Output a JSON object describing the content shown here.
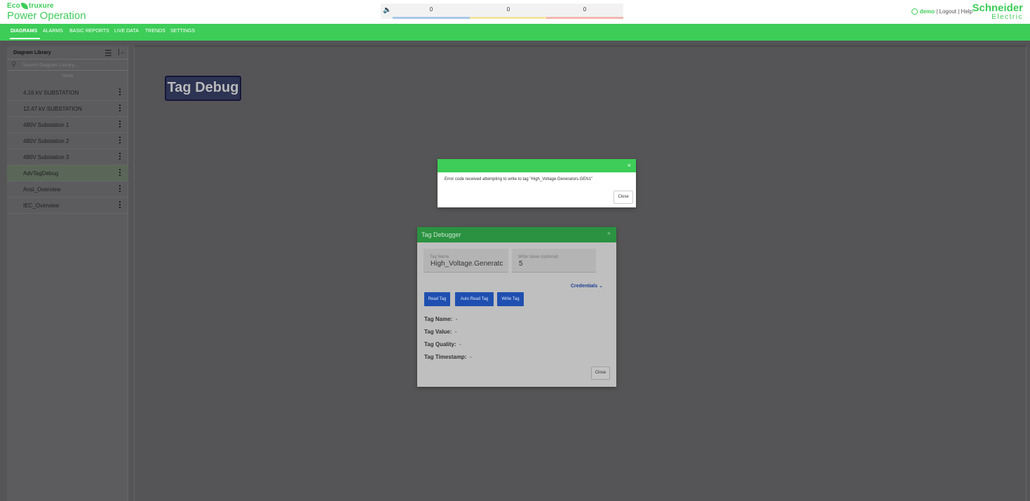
{
  "header": {
    "logo_top": "truxure",
    "logo_prefix": "Eco",
    "app_name": "Power Operation",
    "alarm_counts": [
      "0",
      "0",
      "0"
    ],
    "alarm_colors": [
      "#a9c8ea",
      "#f3e3a2",
      "#f1b8b0"
    ],
    "user": "demo",
    "sep1": "|",
    "logout": "Logout",
    "sep2": "|",
    "help": "Help",
    "brand_line1": "Schneider",
    "brand_line2": "Electric"
  },
  "nav": {
    "items": [
      "DIAGRAMS",
      "ALARMS",
      "BASIC REPORTS",
      "LIVE DATA",
      "TRENDS",
      "SETTINGS"
    ]
  },
  "sidebar": {
    "title": "Diagram Library",
    "search_placeholder": "Search Diagram Library...",
    "home": "Home",
    "items": [
      "4.16 kV SUBSTATION",
      "12.47 kV SUBSTATION",
      "480V Substation 1",
      "480V Substation 2",
      "480V Substation 3",
      "AdvTagDebug",
      "Ansi_Overview",
      "IEC_Overview"
    ],
    "active_index": 5
  },
  "canvas": {
    "tag_debug_button": "Tag Debug"
  },
  "error_dialog": {
    "close_x": "×",
    "message": "Error code received attempting to write to tag \"High_Voltage.Generators.GEN1\"",
    "close_button": "Close"
  },
  "tag_debugger": {
    "title": "Tag Debugger",
    "close_x": "×",
    "tag_name_label": "Tag Name",
    "tag_name_value": "High_Voltage.Generatc",
    "write_value_label": "Write Value (optional)",
    "write_value": "5",
    "credentials": "Credentials",
    "buttons": [
      "Read Tag",
      "Auto Read Tag",
      "Write Tag"
    ],
    "info": [
      {
        "label": "Tag Name:",
        "value": "-"
      },
      {
        "label": "Tag Value:",
        "value": "-"
      },
      {
        "label": "Tag Quality:",
        "value": "-"
      },
      {
        "label": "Tag Timestamp:",
        "value": "-"
      }
    ],
    "close_button": "Close"
  }
}
